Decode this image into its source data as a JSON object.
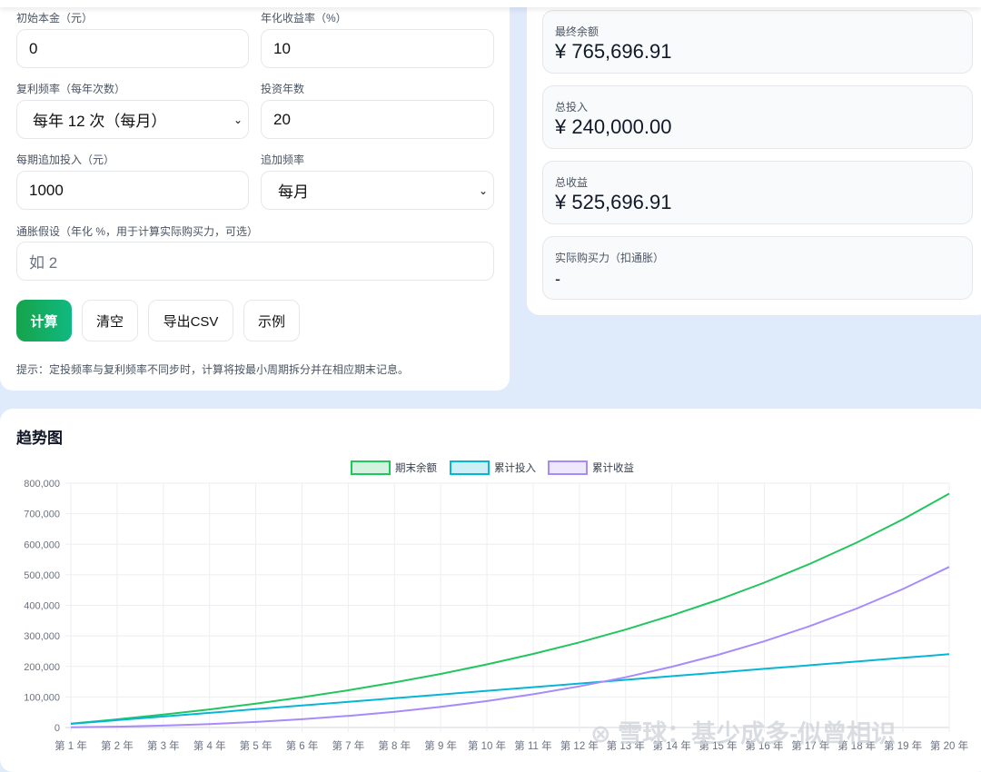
{
  "form": {
    "principal_label": "初始本金（元）",
    "principal_value": "0",
    "rate_label": "年化收益率（%）",
    "rate_value": "10",
    "compound_label": "复利频率（每年次数）",
    "compound_value": "每年 12 次（每月）",
    "years_label": "投资年数",
    "years_value": "20",
    "contrib_label": "每期追加投入（元）",
    "contrib_value": "1000",
    "contrib_freq_label": "追加频率",
    "contrib_freq_value": "每月",
    "inflation_label": "通胀假设（年化 %，用于计算实际购买力，可选）",
    "inflation_placeholder": "如 2",
    "buttons": {
      "calc": "计算",
      "clear": "清空",
      "export": "导出CSV",
      "example": "示例"
    },
    "hint": "提示：定投频率与复利频率不同步时，计算将按最小周期拆分并在相应期末记息。"
  },
  "results": [
    {
      "label": "最终余额",
      "value": "¥ 765,696.91"
    },
    {
      "label": "总投入",
      "value": "¥ 240,000.00"
    },
    {
      "label": "总收益",
      "value": "¥ 525,696.91"
    },
    {
      "label": "实际购买力（扣通胀）",
      "value": "-"
    }
  ],
  "chart_section": {
    "title": "趋势图",
    "watermark": "雪球：基少成多-似曾相识"
  },
  "chart_data": {
    "type": "line",
    "categories": [
      "第 1 年",
      "第 2 年",
      "第 3 年",
      "第 4 年",
      "第 5 年",
      "第 6 年",
      "第 7 年",
      "第 8 年",
      "第 9 年",
      "第 10 年",
      "第 11 年",
      "第 12 年",
      "第 13 年",
      "第 14 年",
      "第 15 年",
      "第 16 年",
      "第 17 年",
      "第 18 年",
      "第 19 年",
      "第 20 年"
    ],
    "series": [
      {
        "name": "期末余额",
        "color": "#22c55e",
        "values": [
          12670,
          26667,
          42130,
          59212,
          78082,
          98929,
          121958,
          147399,
          175505,
          206552,
          240851,
          278742,
          320600,
          366841,
          417924,
          474356,
          536699,
          605568,
          681650,
          765697
        ]
      },
      {
        "name": "累计投入",
        "color": "#06b6d4",
        "values": [
          12000,
          24000,
          36000,
          48000,
          60000,
          72000,
          84000,
          96000,
          108000,
          120000,
          132000,
          144000,
          156000,
          168000,
          180000,
          192000,
          204000,
          216000,
          228000,
          240000
        ]
      },
      {
        "name": "累计收益",
        "color": "#a78bfa",
        "values": [
          670,
          2667,
          6130,
          11212,
          18082,
          26929,
          37958,
          51399,
          67505,
          86552,
          108851,
          134742,
          164600,
          198841,
          237924,
          282356,
          332699,
          389568,
          453650,
          525697
        ]
      }
    ],
    "yticks": [
      "0",
      "100,000",
      "200,000",
      "300,000",
      "400,000",
      "500,000",
      "600,000",
      "700,000",
      "800,000"
    ],
    "ylim": [
      0,
      800000
    ],
    "legend": "top-center",
    "grid": true
  }
}
